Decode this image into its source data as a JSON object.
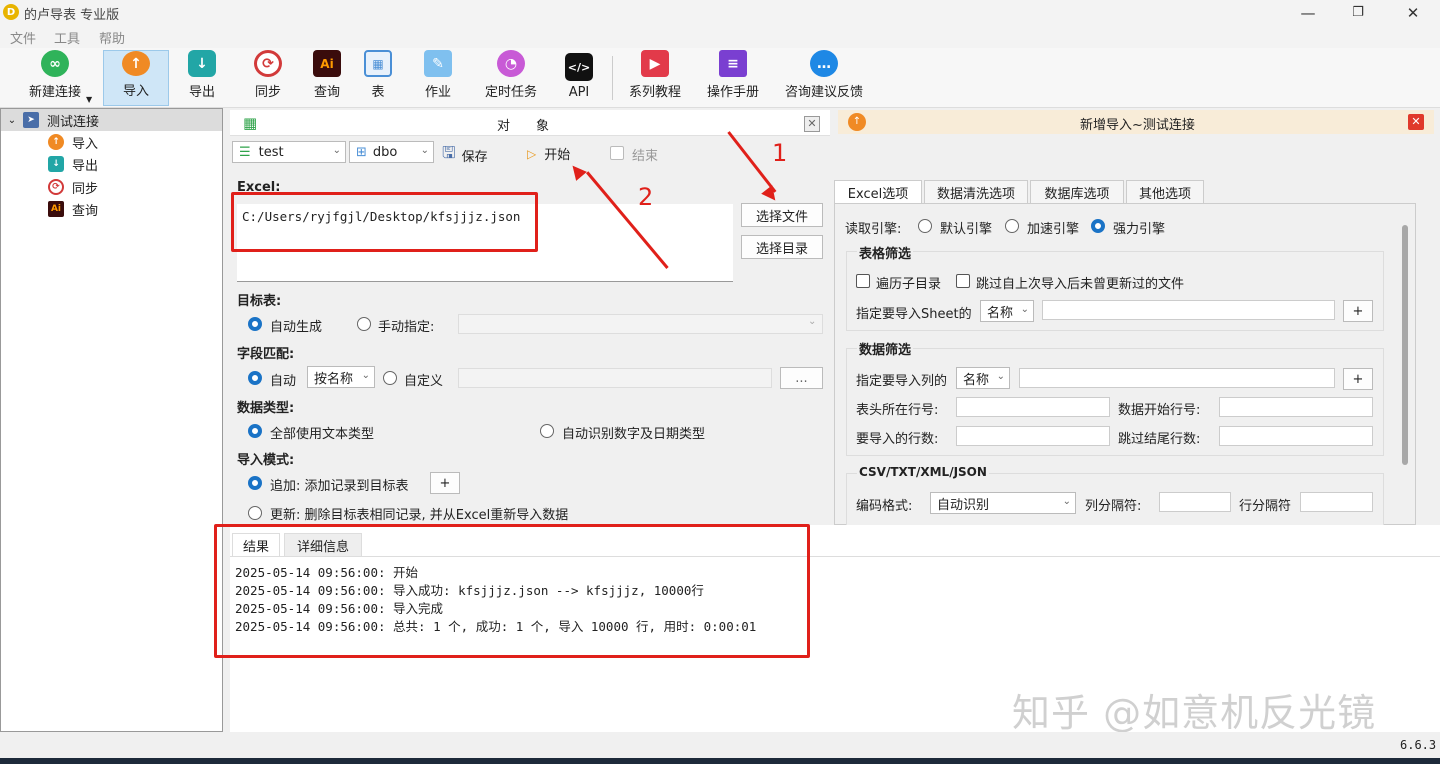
{
  "window": {
    "title": "的卢导表 专业版",
    "minimize": "—",
    "maximize": "❐",
    "close": "✕"
  },
  "menu": [
    "文件",
    "工具",
    "帮助"
  ],
  "toolbar": [
    "新建连接",
    "导入",
    "导出",
    "同步",
    "查询",
    "表",
    "作业",
    "定时任务",
    "API",
    "系列教程",
    "操作手册",
    "咨询建议反馈"
  ],
  "sidebar": {
    "root": "测试连接",
    "items": [
      "导入",
      "导出",
      "同步",
      "查询"
    ]
  },
  "object_panel": {
    "title": "对　　象",
    "database": "test",
    "schema": "dbo",
    "save": "保存",
    "start": "开始",
    "end": "结束",
    "excel_label": "Excel:",
    "file_path": "C:/Users/ryjfgjl/Desktop/kfsjjjz.json",
    "choose_file": "选择文件",
    "choose_dir": "选择目录",
    "target_label": "目标表:",
    "auto_create": "自动生成",
    "manual": "手动指定:",
    "field_match_label": "字段匹配:",
    "field_auto": "自动",
    "field_by": "按名称",
    "field_custom": "自定义",
    "field_more": "...",
    "datatype_label": "数据类型:",
    "dt_text": "全部使用文本类型",
    "dt_auto": "自动识别数字及日期类型",
    "mode_label": "导入模式:",
    "mode_append": "追加: 添加记录到目标表",
    "mode_plus": "+",
    "mode_update": "更新: 删除目标表相同记录, 并从Excel重新导入数据"
  },
  "right_panel": {
    "title": "新增导入~测试连接",
    "tabs": [
      "Excel选项",
      "数据清洗选项",
      "数据库选项",
      "其他选项"
    ],
    "engine_label": "读取引擎:",
    "engines": [
      "默认引擎",
      "加速引擎",
      "强力引擎"
    ],
    "table_filter": "表格筛选",
    "traverse": "遍历子目录",
    "skip_unmodified": "跳过自上次导入后未曾更新过的文件",
    "sheet_label": "指定要导入Sheet的",
    "sheet_by": "名称",
    "plus": "+",
    "data_filter": "数据筛选",
    "col_label": "指定要导入列的",
    "col_by": "名称",
    "header_row": "表头所在行号:",
    "data_start": "数据开始行号:",
    "rows_count": "要导入的行数:",
    "skip_tail": "跳过结尾行数:",
    "csv_label": "CSV/TXT/XML/JSON",
    "encoding_label": "编码格式:",
    "encoding": "自动识别",
    "col_sep": "列分隔符:",
    "row_sep": "行分隔符"
  },
  "results": {
    "tabs": [
      "结果",
      "详细信息"
    ],
    "lines": [
      "2025-05-14 09:56:00: 开始",
      "2025-05-14 09:56:00: 导入成功: kfsjjjz.json --> kfsjjjz, 10000行",
      "2025-05-14 09:56:00: 导入完成",
      "2025-05-14 09:56:00: 总共: 1 个, 成功: 1 个, 导入 10000 行, 用时: 0:00:01"
    ]
  },
  "annotations": [
    "1",
    "2"
  ],
  "watermark": "知乎 @如意机反光镜",
  "version": "6.6.3",
  "icons": {
    "toolbar": [
      "link-icon",
      "import-icon",
      "export-icon",
      "sync-icon",
      "query-icon",
      "table-icon",
      "job-icon",
      "schedule-icon",
      "api-icon",
      "tutorial-icon",
      "manual-icon",
      "feedback-icon"
    ],
    "colors": {
      "accent": "#1a73c6",
      "annotation_red": "#e0201a",
      "import_orange": "#f08a24",
      "export_teal": "#22a6a6"
    }
  }
}
